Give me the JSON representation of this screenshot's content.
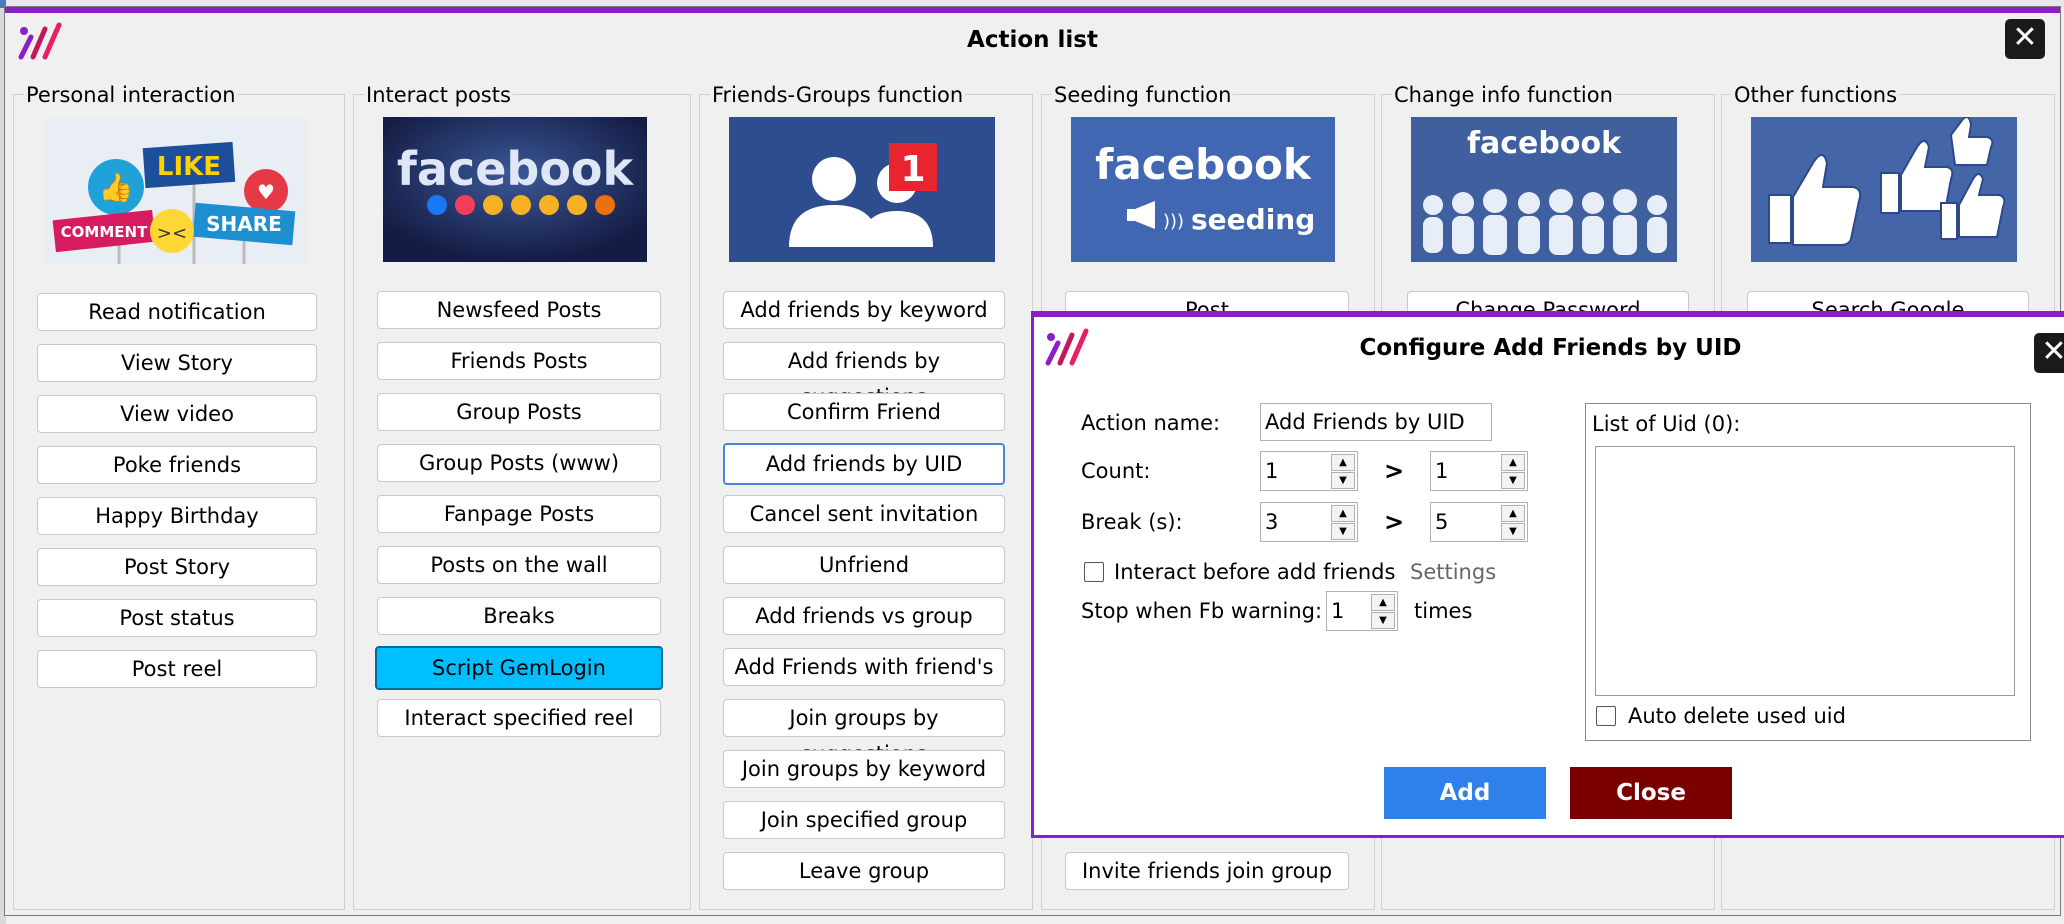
{
  "main_window": {
    "title": "Action list",
    "close_glyph": "✕"
  },
  "groups": [
    {
      "label": "Personal interaction",
      "thumb": "like-comment-share-signs",
      "buttons": [
        "Read notification",
        "View Story",
        "View video",
        "Poke friends",
        "Happy Birthday",
        "Post Story",
        "Post status",
        "Post reel"
      ]
    },
    {
      "label": "Interact posts",
      "thumb": "facebook-reactions",
      "thumb_text": "facebook",
      "buttons": [
        "Newsfeed Posts",
        "Friends Posts",
        "Group Posts",
        "Group Posts (www)",
        "Fanpage Posts",
        "Posts on the wall",
        "Breaks",
        "Script GemLogin",
        "Interact specified reel"
      ],
      "highlighted": "Script GemLogin"
    },
    {
      "label": "Friends-Groups function",
      "thumb": "friend-request-badge",
      "thumb_text": "1",
      "buttons": [
        "Add friends by keyword",
        "Add friends by suggestions",
        "Confirm Friend",
        "Add friends by UID",
        "Cancel sent invitation",
        "Unfriend",
        "Add friends vs group",
        "Add Friends with friend's",
        "Join groups by suggestions",
        "Join groups by keyword",
        "Join specified group",
        "Leave group"
      ],
      "selected": "Add friends by UID"
    },
    {
      "label": "Seeding function",
      "thumb": "facebook-seeding",
      "thumb_text": "facebook",
      "thumb_sub": "seeding",
      "buttons": [
        "Post",
        "Invite friends join group"
      ]
    },
    {
      "label": "Change info function",
      "thumb": "facebook-crowd",
      "thumb_text": "facebook",
      "buttons": [
        "Change Password"
      ]
    },
    {
      "label": "Other functions",
      "thumb": "thumbs-up-crowd",
      "buttons": [
        "Search Google"
      ]
    }
  ],
  "dialog": {
    "title": "Configure Add Friends by UID",
    "close_glyph": "✕",
    "action_name_label": "Action name:",
    "action_name_value": "Add Friends by UID",
    "count_label": "Count:",
    "count_min": "1",
    "count_max": "1",
    "break_label": "Break (s):",
    "break_min": "3",
    "break_max": "5",
    "range_symbol": ">",
    "interact_label": "Interact before add friends",
    "settings_link": "Settings",
    "stop_label": "Stop when Fb warning:",
    "stop_value": "1",
    "stop_unit": "times",
    "uid_list_label": "List of Uid (0):",
    "auto_delete_label": "Auto delete used uid",
    "add_button": "Add",
    "close_button": "Close"
  },
  "colors": {
    "accent_purple": "#8a1ec8",
    "add_blue": "#2f80e8",
    "close_red": "#7a0000",
    "highlight_cyan": "#00bfff",
    "fb_blue": "#3b5998"
  }
}
